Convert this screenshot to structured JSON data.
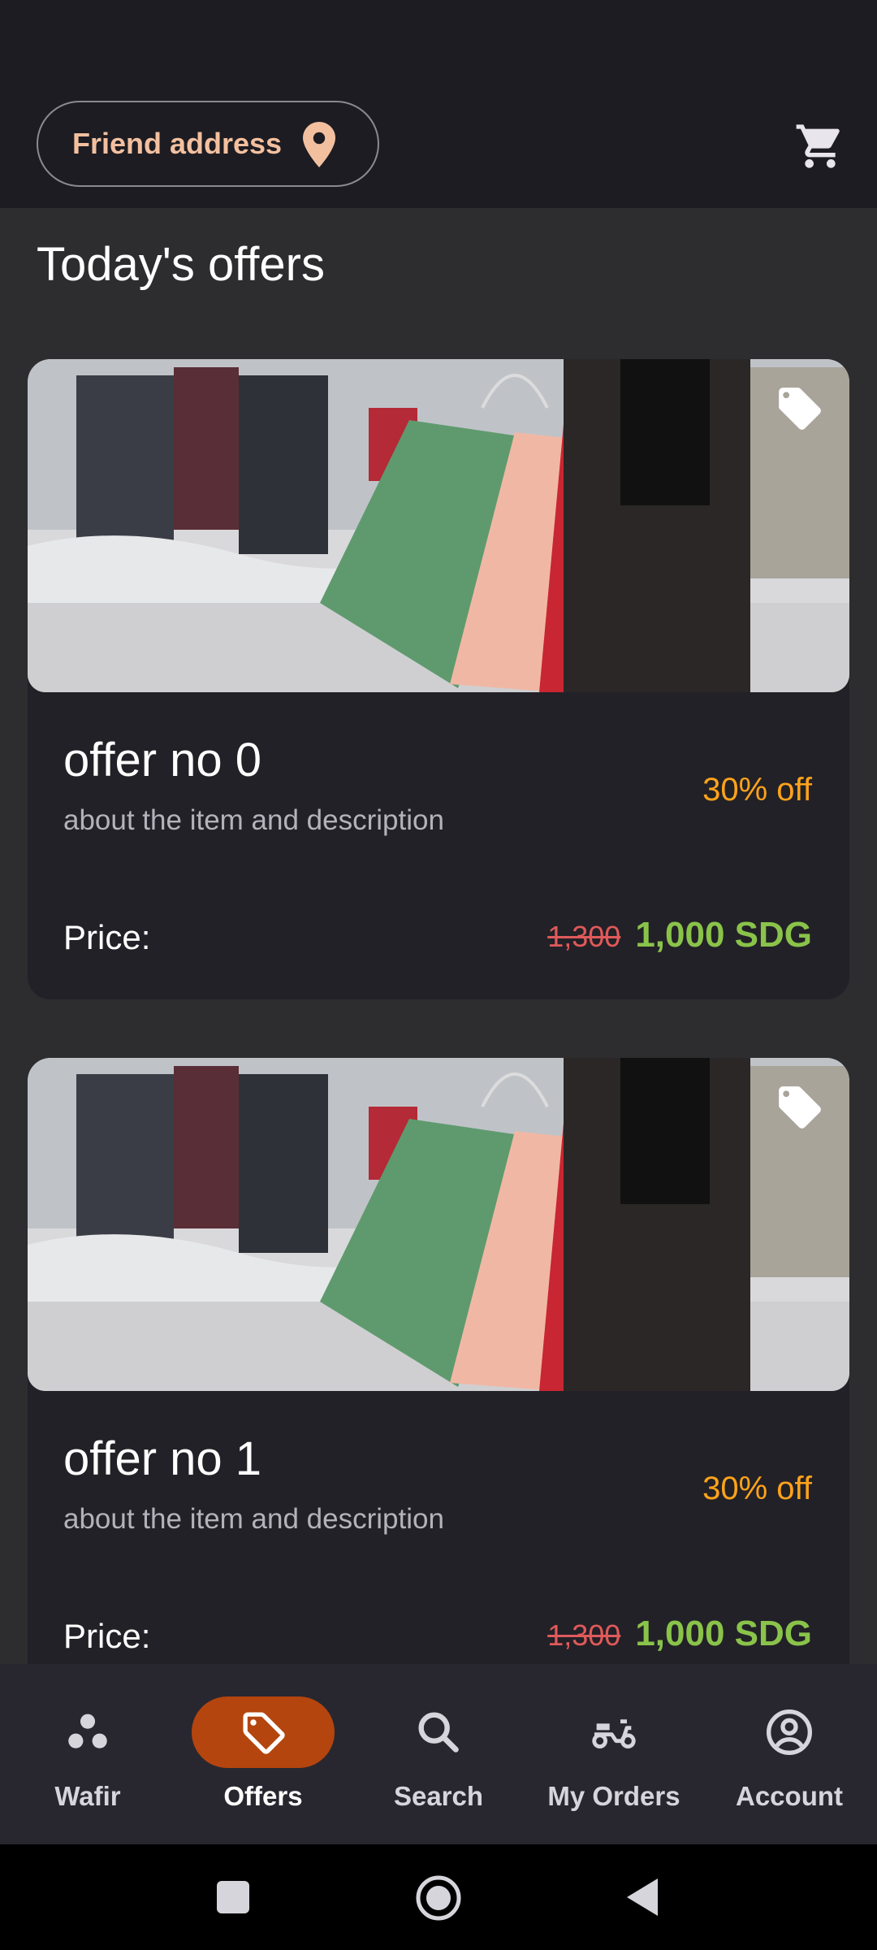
{
  "topbar": {
    "address_label": "Friend address",
    "pin_icon": "location-pin-icon",
    "cart_icon": "shopping-cart-icon",
    "accent_color": "#f3c09f"
  },
  "main": {
    "section_title": "Today's offers",
    "offers": [
      {
        "title": "offer no 0",
        "description": "about the item and description",
        "discount": "30% off",
        "price_label": "Price:",
        "old_price": "1,300",
        "new_price": "1,000 SDG",
        "image": "shopping-bags-photo",
        "badge_icon": "tag-icon"
      },
      {
        "title": "offer no 1",
        "description": "about the item and description",
        "discount": "30% off",
        "price_label": "Price:",
        "old_price": "1,300",
        "new_price": "1,000 SDG",
        "image": "shopping-bags-photo",
        "badge_icon": "tag-icon"
      }
    ]
  },
  "bottom_nav": {
    "active_color": "#b4450e",
    "items": [
      {
        "label": "Wafir",
        "icon": "dots-icon",
        "active": false
      },
      {
        "label": "Offers",
        "icon": "tag-icon",
        "active": true
      },
      {
        "label": "Search",
        "icon": "search-icon",
        "active": false
      },
      {
        "label": "My Orders",
        "icon": "scooter-icon",
        "active": false
      },
      {
        "label": "Account",
        "icon": "account-icon",
        "active": false
      }
    ]
  },
  "system_nav": {
    "recents_icon": "square-icon",
    "home_icon": "circle-icon",
    "back_icon": "triangle-back-icon"
  }
}
